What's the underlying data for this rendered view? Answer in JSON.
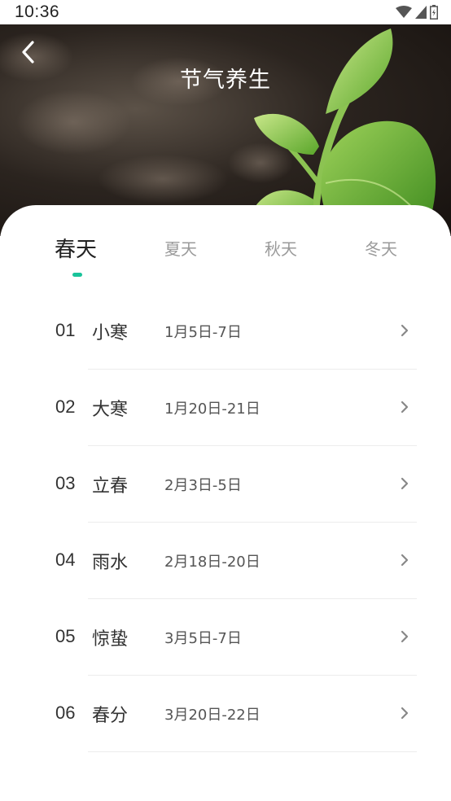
{
  "status": {
    "time": "10:36"
  },
  "header": {
    "title": "节气养生"
  },
  "tabs": [
    {
      "label": "春天",
      "active": true
    },
    {
      "label": "夏天",
      "active": false
    },
    {
      "label": "秋天",
      "active": false
    },
    {
      "label": "冬天",
      "active": false
    }
  ],
  "terms": [
    {
      "num": "01",
      "name": "小寒",
      "date": "1月5日-7日"
    },
    {
      "num": "02",
      "name": "大寒",
      "date": "1月20日-21日"
    },
    {
      "num": "03",
      "name": "立春",
      "date": "2月3日-5日"
    },
    {
      "num": "04",
      "name": "雨水",
      "date": "2月18日-20日"
    },
    {
      "num": "05",
      "name": "惊蛰",
      "date": "3月5日-7日"
    },
    {
      "num": "06",
      "name": "春分",
      "date": "3月20日-22日"
    }
  ],
  "colors": {
    "accent": "#19c39a",
    "text": "#333333",
    "muted": "#9a9a9a"
  },
  "icons": {
    "back": "chevron-left-icon",
    "row_arrow": "chevron-right-icon",
    "wifi": "wifi-icon",
    "signal": "signal-icon",
    "battery": "battery-icon"
  }
}
